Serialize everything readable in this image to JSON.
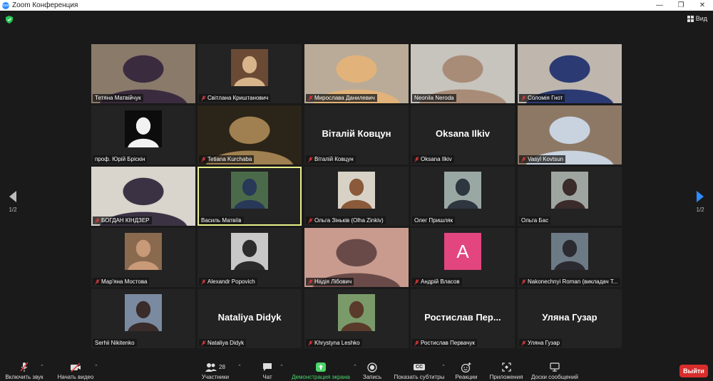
{
  "window": {
    "title": "Zoom Конференция",
    "minimize": "—",
    "maximize": "❐",
    "close": "✕"
  },
  "view_label": "Вид",
  "pager": {
    "left_text": "1/2",
    "right_text": "1/2"
  },
  "participants": [
    {
      "name": "Тетяна Матвійчук",
      "muted": false,
      "kind": "video",
      "bg": "#8a7a6a",
      "fg": "#3b2b3f"
    },
    {
      "name": "Світлана Криштанович",
      "muted": true,
      "kind": "photo",
      "bg": "#6b4a35",
      "fg": "#d8b48a"
    },
    {
      "name": "Мирослава Данилевич",
      "muted": true,
      "kind": "video",
      "bg": "#b9ab98",
      "fg": "#e1b27a"
    },
    {
      "name": "Neonila Neroda",
      "muted": false,
      "kind": "video",
      "bg": "#c7c4bd",
      "fg": "#a88c78"
    },
    {
      "name": "Соломія Гнот",
      "muted": true,
      "kind": "video",
      "bg": "#bfb7ae",
      "fg": "#2b3a72"
    },
    {
      "name": "проф. Юрій Бріскін",
      "muted": false,
      "kind": "photo",
      "bg": "#0c0c0c",
      "fg": "#f2f2f2"
    },
    {
      "name": "Tetiana Kurchaba",
      "muted": true,
      "kind": "video",
      "bg": "#2b2418",
      "fg": "#a08050"
    },
    {
      "name": "Віталій Ковцун",
      "muted": true,
      "kind": "name",
      "big": "Віталій Ковцун"
    },
    {
      "name": "Oksana Ilkiv",
      "muted": true,
      "kind": "name",
      "big": "Oksana Ilkiv"
    },
    {
      "name": "Vasyl Kovtsun",
      "muted": true,
      "kind": "video",
      "bg": "#8d7866",
      "fg": "#c9d3e0"
    },
    {
      "name": "БОГДАН КІНДЗЕР",
      "muted": true,
      "kind": "video",
      "bg": "#d9d4cc",
      "fg": "#3b3344"
    },
    {
      "name": "Василь Матвіїв",
      "muted": false,
      "kind": "photo",
      "bg": "#4b6a4a",
      "fg": "#283858",
      "active": true
    },
    {
      "name": "Ольга Зіньків (Olha Zinkiv)",
      "muted": true,
      "kind": "photo",
      "bg": "#d8d2c6",
      "fg": "#8a5a3a"
    },
    {
      "name": "Олег Пришляк",
      "muted": false,
      "kind": "photo",
      "bg": "#9aa8a4",
      "fg": "#2e3640"
    },
    {
      "name": "Ольга Бас",
      "muted": false,
      "kind": "photo",
      "bg": "#9fa6a1",
      "fg": "#3a2c2a"
    },
    {
      "name": "Мар'яна Мостова",
      "muted": true,
      "kind": "photo",
      "bg": "#8a6a4e",
      "fg": "#c99a78"
    },
    {
      "name": "Alexandr  Popovich",
      "muted": true,
      "kind": "photo",
      "bg": "#c8c8c8",
      "fg": "#2c2c2c"
    },
    {
      "name": "Надія Лібович",
      "muted": true,
      "kind": "video",
      "bg": "#c99b8f",
      "fg": "#6a4a48"
    },
    {
      "name": "Андрій Власов",
      "muted": true,
      "kind": "avatar",
      "letter": "A"
    },
    {
      "name": "Nakonechnyi Roman (викладач Т...",
      "muted": true,
      "kind": "photo",
      "bg": "#6c7a86",
      "fg": "#2a2a30"
    },
    {
      "name": "Serhii Nikitenko",
      "muted": false,
      "kind": "photo",
      "bg": "#7a8aa0",
      "fg": "#3a2c2a"
    },
    {
      "name": "Nataliya Didyk",
      "muted": true,
      "kind": "name",
      "big": "Nataliya Didyk"
    },
    {
      "name": "Khrystyna Leshko",
      "muted": true,
      "kind": "photo",
      "bg": "#7a9a6a",
      "fg": "#5a3a2a"
    },
    {
      "name": "Ростислав Первачук",
      "muted": true,
      "kind": "name",
      "big": "Ростислав  Пер..."
    },
    {
      "name": "Уляна Гузар",
      "muted": true,
      "kind": "name",
      "big": "Уляна Гузар"
    }
  ],
  "toolbar": {
    "audio": "Включить звук",
    "video": "Начать видео",
    "participants": "Участники",
    "participants_count": "28",
    "chat": "Чат",
    "share": "Демонстрация экрана",
    "record": "Запись",
    "captions": "Показать субтитры",
    "captions_icon": "CC",
    "reactions": "Реакции",
    "apps": "Приложения",
    "whiteboards": "Доски сообщений",
    "leave": "Выйти"
  },
  "colors": {
    "share_green": "#4bd46a",
    "leave_red": "#d92d2d",
    "active_outline": "#e9f28a",
    "avatar_pink": "#e3457f"
  }
}
